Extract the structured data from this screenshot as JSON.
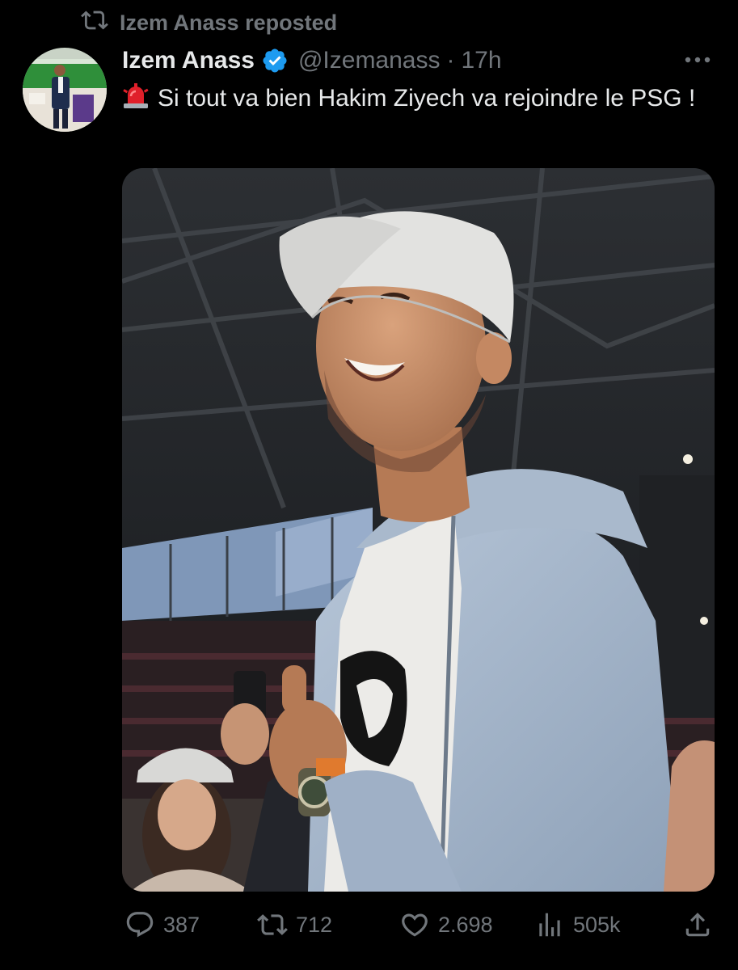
{
  "repost_banner": {
    "text": "Izem Anass reposted",
    "icon": "repost-icon"
  },
  "post": {
    "author_name": "Izem Anass",
    "verified": true,
    "verified_color": "#1d9bf0",
    "handle": "@Izemanass",
    "separator": "·",
    "time": "17h",
    "more_icon": "more-icon",
    "emoji": "siren-emoji",
    "text": "Si tout va bien Hakim Ziyech va rejoindre le PSG !",
    "media": {
      "type": "photo"
    }
  },
  "actions": {
    "replies": "387",
    "reposts": "712",
    "likes": "2.698",
    "views": "505k",
    "share_icon": "share-icon"
  },
  "colors": {
    "background": "#000000",
    "text_primary": "#e7e9ea",
    "text_secondary": "#71767b"
  }
}
